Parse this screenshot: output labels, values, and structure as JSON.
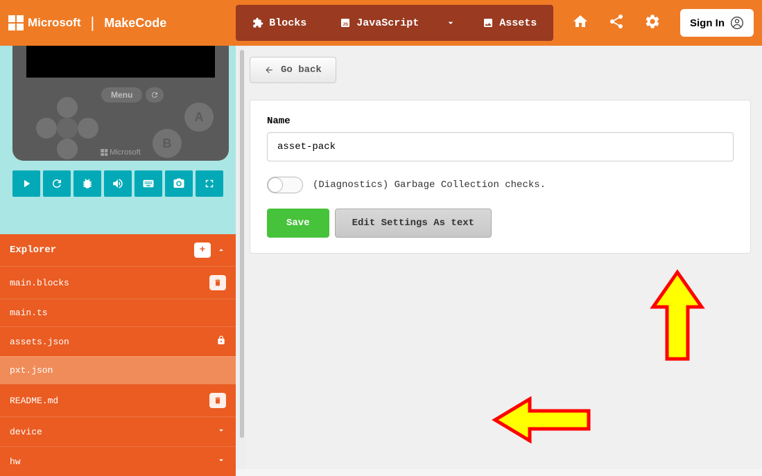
{
  "header": {
    "microsoft": "Microsoft",
    "makecode": "MakeCode",
    "tabs": {
      "blocks": "Blocks",
      "javascript": "JavaScript",
      "assets": "Assets"
    },
    "signin": "Sign In"
  },
  "sim": {
    "menu": "Menu",
    "a": "A",
    "b": "B",
    "microsoft": "Microsoft"
  },
  "explorer": {
    "title": "Explorer",
    "items": [
      {
        "label": "main.blocks",
        "trash": true
      },
      {
        "label": "main.ts"
      },
      {
        "label": "assets.json",
        "lock": true
      },
      {
        "label": "pxt.json",
        "selected": true
      },
      {
        "label": "README.md",
        "trash": true
      },
      {
        "label": "device",
        "chevron": true
      },
      {
        "label": "hw",
        "chevron": true
      }
    ]
  },
  "content": {
    "back": "Go back",
    "name_label": "Name",
    "name_value": "asset-pack",
    "diag_label": "(Diagnostics) Garbage Collection checks.",
    "save": "Save",
    "edit_text": "Edit Settings As text"
  }
}
